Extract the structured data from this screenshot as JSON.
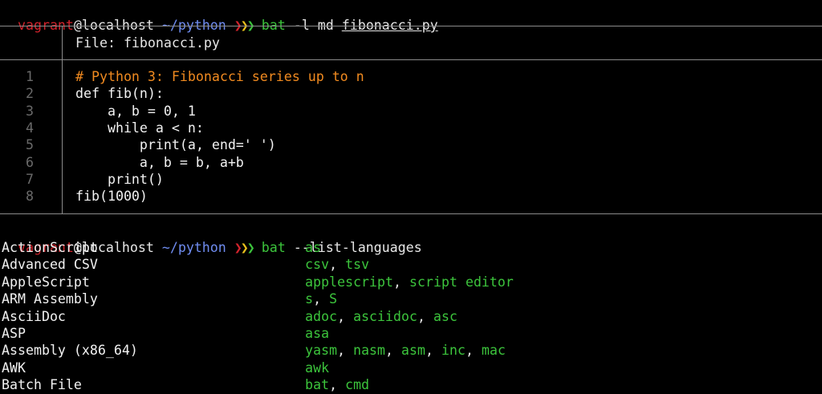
{
  "prompt": {
    "user": "vagrant",
    "at": "@",
    "host": "localhost",
    "path": "~/python",
    "chevron": "❯❯❯"
  },
  "command1": {
    "cmd": "bat",
    "args": "-l md",
    "file": "fibonacci.py"
  },
  "file_header": "File: fibonacci.py",
  "code_lines": [
    {
      "num": "1",
      "text": "# Python 3: Fibonacci series up to n",
      "type": "comment"
    },
    {
      "num": "2",
      "text": "def fib(n):",
      "type": "code"
    },
    {
      "num": "3",
      "text": "    a, b = 0, 1",
      "type": "code"
    },
    {
      "num": "4",
      "text": "    while a < n:",
      "type": "code"
    },
    {
      "num": "5",
      "text": "        print(a, end=' ')",
      "type": "code"
    },
    {
      "num": "6",
      "text": "        a, b = b, a+b",
      "type": "code"
    },
    {
      "num": "7",
      "text": "    print()",
      "type": "code"
    },
    {
      "num": "8",
      "text": "fib(1000)",
      "type": "code"
    }
  ],
  "command2": {
    "cmd": "bat",
    "args": "--list-languages"
  },
  "languages": [
    {
      "name": "ActionScript",
      "exts": [
        "as"
      ]
    },
    {
      "name": "Advanced CSV",
      "exts": [
        "csv",
        "tsv"
      ]
    },
    {
      "name": "AppleScript",
      "exts": [
        "applescript",
        "script editor"
      ]
    },
    {
      "name": "ARM Assembly",
      "exts": [
        "s",
        "S"
      ]
    },
    {
      "name": "AsciiDoc",
      "exts": [
        "adoc",
        "asciidoc",
        "asc"
      ]
    },
    {
      "name": "ASP",
      "exts": [
        "asa"
      ]
    },
    {
      "name": "Assembly (x86_64)",
      "exts": [
        "yasm",
        "nasm",
        "asm",
        "inc",
        "mac"
      ]
    },
    {
      "name": "AWK",
      "exts": [
        "awk"
      ]
    },
    {
      "name": "Batch File",
      "exts": [
        "bat",
        "cmd"
      ]
    }
  ],
  "colors": {
    "background": "#000000",
    "prompt_user": "#d2232c",
    "prompt_path": "#6f8cf0",
    "command": "#3cc43c",
    "comment": "#f08a20",
    "line_number": "#6a6a6a",
    "border": "#8a8a8a"
  }
}
